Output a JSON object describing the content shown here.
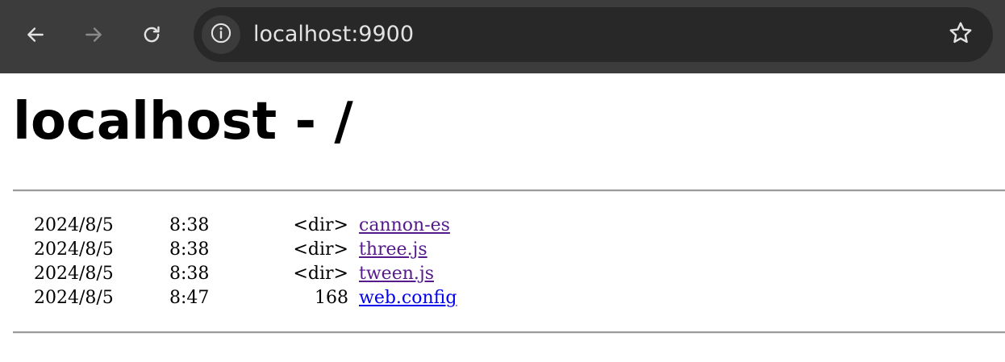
{
  "browser": {
    "url": "localhost:9900",
    "icons": {
      "back": "arrow-left-icon",
      "forward": "arrow-right-icon",
      "reload": "reload-icon",
      "site_info": "info-icon",
      "bookmark": "star-icon"
    },
    "colors": {
      "toolbar_bg": "#3c3c3c",
      "omnibox_bg": "#282828",
      "url_text": "#e3e3e3"
    }
  },
  "page": {
    "heading": "localhost - /",
    "entries": [
      {
        "date": "2024/8/5",
        "time": "8:38",
        "size": "<dir>",
        "name": "cannon-es",
        "visited": true
      },
      {
        "date": "2024/8/5",
        "time": "8:38",
        "size": "<dir>",
        "name": "three.js",
        "visited": true
      },
      {
        "date": "2024/8/5",
        "time": "8:38",
        "size": "<dir>",
        "name": "tween.js",
        "visited": true
      },
      {
        "date": "2024/8/5",
        "time": "8:47",
        "size": "168",
        "name": "web.config",
        "visited": false
      }
    ],
    "colors": {
      "link_visited": "#551a8b",
      "link_unvisited": "#0000ee"
    }
  }
}
